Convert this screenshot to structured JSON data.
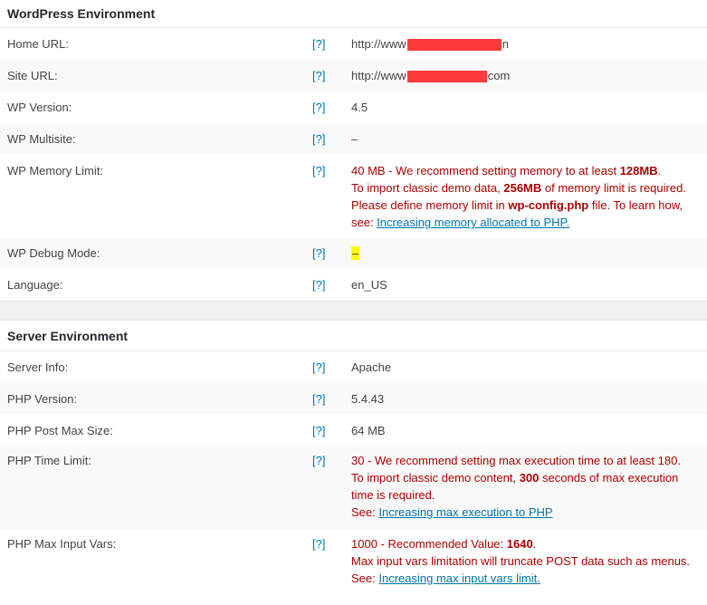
{
  "wp_env": {
    "title": "WordPress Environment",
    "help": "[?]",
    "home_url": {
      "label": "Home URL:",
      "prefix": "http://www",
      "suffix": "n"
    },
    "site_url": {
      "label": "Site URL:",
      "prefix": "http://www",
      "suffix": "com"
    },
    "wp_version": {
      "label": "WP Version:",
      "value": "4.5"
    },
    "wp_multisite": {
      "label": "WP Multisite:",
      "value": "–"
    },
    "memory": {
      "label": "WP Memory Limit:",
      "p1": "40 MB - We recommend setting memory to at least ",
      "b1": "128MB",
      "p2": ".",
      "p3": "To import classic demo data, ",
      "b2": "256MB",
      "p4": " of memory limit is required.",
      "p5": "Please define memory limit in ",
      "b3": "wp-config.php",
      "p6": " file. To learn how,",
      "p7": "see: ",
      "link": "Increasing memory allocated to PHP."
    },
    "debug": {
      "label": "WP Debug Mode:",
      "value": "–"
    },
    "language": {
      "label": "Language:",
      "value": "en_US"
    }
  },
  "server_env": {
    "title": "Server Environment",
    "help": "[?]",
    "server_info": {
      "label": "Server Info:",
      "value": "Apache"
    },
    "php_version": {
      "label": "PHP Version:",
      "value": "5.4.43"
    },
    "post_max": {
      "label": "PHP Post Max Size:",
      "value": "64 MB"
    },
    "time_limit": {
      "label": "PHP Time Limit:",
      "l1": "30 - We recommend setting max execution time to at least 180.",
      "p1": "To import classic demo content, ",
      "b1": "300",
      "p2": " seconds of max execution",
      "l3": "time is required.",
      "see": "See: ",
      "link": "Increasing max execution to PHP"
    },
    "input_vars": {
      "label": "PHP Max Input Vars:",
      "p1": "1000 - Recommended Value: ",
      "b1": "1640",
      "p2": ".",
      "l2": "Max input vars limitation will truncate POST data such as menus.",
      "see": "See: ",
      "link": "Increasing max input vars limit."
    }
  }
}
